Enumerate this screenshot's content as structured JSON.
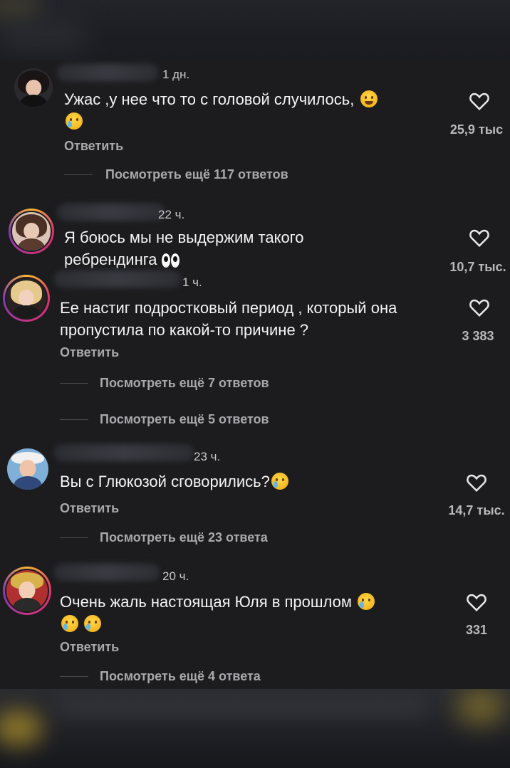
{
  "comments": [
    {
      "time": "1 дн.",
      "text": "Ужас ,у нее что то с головой случилось,",
      "emojis": [
        "joy-emoji",
        "crying-emoji"
      ],
      "reply_label": "Ответить",
      "likes": "25,9 тыс",
      "more_replies": "Посмотреть ещё 117 ответов"
    },
    {
      "time": "22 ч.",
      "text": "Я боюсь мы не выдержим такого ребрендинга",
      "emojis": [
        "eyes-emoji"
      ],
      "likes": "10,7 тыс."
    },
    {
      "time": "1 ч.",
      "text": "Ее настиг подростковый период , который она пропустила по какой-то причине ?",
      "reply_label": "Ответить",
      "likes": "3 383",
      "more_replies": "Посмотреть ещё 7 ответов",
      "more_replies_2": "Посмотреть ещё 5 ответов"
    },
    {
      "time": "23 ч.",
      "text": "Вы с Глюкозой сговорились?",
      "emojis": [
        "crying-emoji"
      ],
      "reply_label": "Ответить",
      "likes": "14,7 тыс.",
      "more_replies": "Посмотреть ещё 23 ответа"
    },
    {
      "time": "20 ч.",
      "text": "Очень жаль настоящая Юля в прошлом",
      "emojis": [
        "crying-emoji",
        "crying-emoji",
        "crying-emoji"
      ],
      "reply_label": "Ответить",
      "likes": "331",
      "more_replies": "Посмотреть ещё 4 ответа"
    }
  ],
  "colors": {
    "background": "#1c1c1f",
    "text": "#f4f4f4",
    "muted": "#a9a9ad",
    "story_ring": "#e1306c"
  },
  "icons": [
    "heart-outline-icon"
  ]
}
